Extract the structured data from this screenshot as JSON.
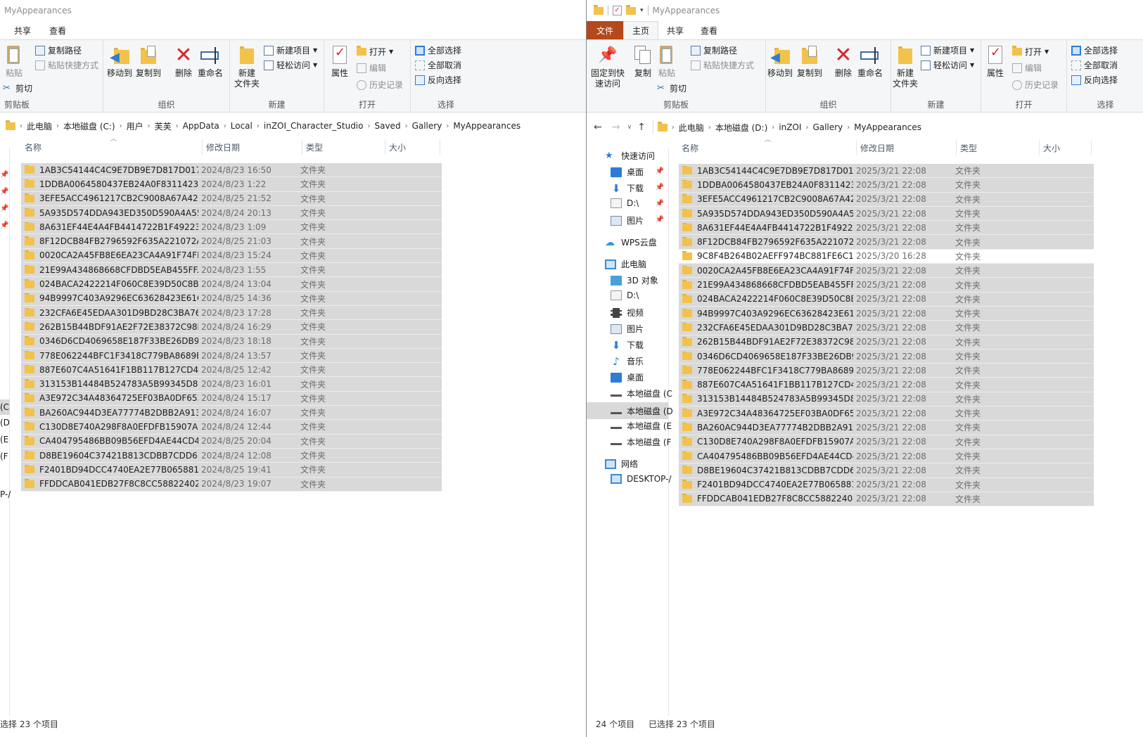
{
  "left": {
    "title": "MyAppearances",
    "tabs": [
      "共享",
      "查看"
    ],
    "ribbon": {
      "clipboard": {
        "group": "剪贴板",
        "paste": "粘贴",
        "copy_path": "复制路径",
        "paste_shortcut": "粘贴快捷方式",
        "cut": "剪切"
      },
      "organize": {
        "group": "组织",
        "move_to": "移动到",
        "copy_to": "复制到",
        "delete": "删除",
        "rename": "重命名"
      },
      "new": {
        "group": "新建",
        "new_folder": "新建\n文件夹",
        "new_item": "新建项目",
        "easy_access": "轻松访问"
      },
      "open": {
        "group": "打开",
        "properties": "属性",
        "open": "打开",
        "edit": "编辑",
        "history": "历史记录"
      },
      "select": {
        "group": "选择",
        "select_all": "全部选择",
        "select_none": "全部取消",
        "invert": "反向选择"
      }
    },
    "breadcrumb": [
      "此电脑",
      "本地磁盘 (C:)",
      "用户",
      "芙芙",
      "AppData",
      "Local",
      "inZOI_Character_Studio",
      "Saved",
      "Gallery",
      "MyAppearances"
    ],
    "columns": [
      "名称",
      "修改日期",
      "类型",
      "大小"
    ],
    "nav_fragments": [
      "(C",
      "(D",
      "(E",
      "(F",
      "P-/"
    ],
    "files": [
      {
        "name": "1AB3C54144C4C9E7DB9E7D817D017...",
        "date": "2024/8/23 16:50",
        "type": "文件夹"
      },
      {
        "name": "1DDBA0064580437EB24A0F83114231...",
        "date": "2024/8/23 1:22",
        "type": "文件夹"
      },
      {
        "name": "3EFE5ACC4961217CB2C9008A67A428...",
        "date": "2024/8/25 21:52",
        "type": "文件夹"
      },
      {
        "name": "5A935D574DDA943ED350D590A4A55...",
        "date": "2024/8/24 20:13",
        "type": "文件夹"
      },
      {
        "name": "8A631EF44E4A4FB4414722B1F49223F6",
        "date": "2024/8/23 1:09",
        "type": "文件夹"
      },
      {
        "name": "8F12DCB84FB2796592F635A221072A...",
        "date": "2024/8/25 21:03",
        "type": "文件夹"
      },
      {
        "name": "0020CA2A45FB8E6EA23CA4A91F74FF...",
        "date": "2024/8/23 15:24",
        "type": "文件夹"
      },
      {
        "name": "21E99A434868668CFDBD5EAB455FF...",
        "date": "2024/8/23 1:55",
        "type": "文件夹"
      },
      {
        "name": "024BACA2422214F060C8E39D50C8B...",
        "date": "2024/8/24 13:04",
        "type": "文件夹"
      },
      {
        "name": "94B9997C403A9296EC63628423E61C...",
        "date": "2024/8/25 14:36",
        "type": "文件夹"
      },
      {
        "name": "232CFA6E45EDAA301D9BD28C3BA76...",
        "date": "2024/8/23 17:28",
        "type": "文件夹"
      },
      {
        "name": "262B15B44BDF91AE2F72E38372C98E...",
        "date": "2024/8/24 16:29",
        "type": "文件夹"
      },
      {
        "name": "0346D6CD4069658E187F33BE26DB9...",
        "date": "2024/8/23 18:18",
        "type": "文件夹"
      },
      {
        "name": "778E062244BFC1F3418C779BA8689B...",
        "date": "2024/8/24 13:57",
        "type": "文件夹"
      },
      {
        "name": "887E607C4A51641F1BB117B127CD4...",
        "date": "2024/8/25 12:42",
        "type": "文件夹"
      },
      {
        "name": "313153B14484B524783A5B99345D89...",
        "date": "2024/8/23 16:01",
        "type": "文件夹"
      },
      {
        "name": "A3E972C34A48364725EF03BA0DF653...",
        "date": "2024/8/24 15:17",
        "type": "文件夹"
      },
      {
        "name": "BA260AC944D3EA77774B2DBB2A913...",
        "date": "2024/8/24 16:07",
        "type": "文件夹"
      },
      {
        "name": "C130D8E740A298F8A0EFDFB15907A5...",
        "date": "2024/8/24 12:44",
        "type": "文件夹"
      },
      {
        "name": "CA404795486BB09B56EFD4AE44CD4...",
        "date": "2024/8/25 20:04",
        "type": "文件夹"
      },
      {
        "name": "D8BE19604C37421B813CDBB7CDD6...",
        "date": "2024/8/24 12:08",
        "type": "文件夹"
      },
      {
        "name": "F2401BD94DCC4740EA2E77B065881F...",
        "date": "2024/8/25 19:41",
        "type": "文件夹"
      },
      {
        "name": "FFDDCAB041EDB27F8C8CC58822402...",
        "date": "2024/8/23 19:07",
        "type": "文件夹"
      }
    ],
    "status": "选择 23 个项目"
  },
  "right": {
    "title": "MyAppearances",
    "tabs": [
      "文件",
      "主页",
      "共享",
      "查看"
    ],
    "ribbon": {
      "clipboard": {
        "group": "剪贴板",
        "pin": "固定到快\n速访问",
        "copy": "复制",
        "paste": "粘贴",
        "copy_path": "复制路径",
        "paste_shortcut": "粘贴快捷方式",
        "cut": "剪切"
      },
      "organize": {
        "group": "组织",
        "move_to": "移动到",
        "copy_to": "复制到",
        "delete": "删除",
        "rename": "重命名"
      },
      "new": {
        "group": "新建",
        "new_folder": "新建\n文件夹",
        "new_item": "新建项目",
        "easy_access": "轻松访问"
      },
      "open": {
        "group": "打开",
        "properties": "属性",
        "open": "打开",
        "edit": "编辑",
        "history": "历史记录"
      },
      "select": {
        "group": "选择",
        "select_all": "全部选择",
        "select_none": "全部取消",
        "invert": "反向选择"
      }
    },
    "breadcrumb": [
      "此电脑",
      "本地磁盘 (D:)",
      "inZOI",
      "Gallery",
      "MyAppearances"
    ],
    "columns": [
      "名称",
      "修改日期",
      "类型",
      "大小"
    ],
    "nav": {
      "quick_access": "快速访问",
      "quick_items": [
        "桌面",
        "下载",
        "D:\\",
        "图片"
      ],
      "wps": "WPS云盘",
      "this_pc": "此电脑",
      "pc_items": [
        "3D 对象",
        "D:\\",
        "视频",
        "图片",
        "下载",
        "音乐",
        "桌面",
        "本地磁盘 (C",
        "本地磁盘 (D",
        "本地磁盘 (E",
        "本地磁盘 (F"
      ],
      "network": "网络",
      "desktop": "DESKTOP-/"
    },
    "files": [
      {
        "name": "1AB3C54144C4C9E7DB9E7D817D017...",
        "date": "2025/3/21 22:08",
        "type": "文件夹",
        "selected": true
      },
      {
        "name": "1DDBA0064580437EB24A0F83114231...",
        "date": "2025/3/21 22:08",
        "type": "文件夹",
        "selected": true
      },
      {
        "name": "3EFE5ACC4961217CB2C9008A67A428...",
        "date": "2025/3/21 22:08",
        "type": "文件夹",
        "selected": true
      },
      {
        "name": "5A935D574DDA943ED350D590A4A55...",
        "date": "2025/3/21 22:08",
        "type": "文件夹",
        "selected": true
      },
      {
        "name": "8A631EF44E4A4FB4414722B1F49223F6",
        "date": "2025/3/21 22:08",
        "type": "文件夹",
        "selected": true
      },
      {
        "name": "8F12DCB84FB2796592F635A221072A...",
        "date": "2025/3/21 22:08",
        "type": "文件夹",
        "selected": true
      },
      {
        "name": "9C8F4B264B02AEFF974BC881FE6C14...",
        "date": "2025/3/20 16:28",
        "type": "文件夹",
        "selected": false
      },
      {
        "name": "0020CA2A45FB8E6EA23CA4A91F74FF...",
        "date": "2025/3/21 22:08",
        "type": "文件夹",
        "selected": true
      },
      {
        "name": "21E99A434868668CFDBD5EAB455FF...",
        "date": "2025/3/21 22:08",
        "type": "文件夹",
        "selected": true
      },
      {
        "name": "024BACA2422214F060C8E39D50C8B...",
        "date": "2025/3/21 22:08",
        "type": "文件夹",
        "selected": true
      },
      {
        "name": "94B9997C403A9296EC63628423E61C...",
        "date": "2025/3/21 22:08",
        "type": "文件夹",
        "selected": true
      },
      {
        "name": "232CFA6E45EDAA301D9BD28C3BA76...",
        "date": "2025/3/21 22:08",
        "type": "文件夹",
        "selected": true
      },
      {
        "name": "262B15B44BDF91AE2F72E38372C98E...",
        "date": "2025/3/21 22:08",
        "type": "文件夹",
        "selected": true
      },
      {
        "name": "0346D6CD4069658E187F33BE26DB9...",
        "date": "2025/3/21 22:08",
        "type": "文件夹",
        "selected": true
      },
      {
        "name": "778E062244BFC1F3418C779BA8689B...",
        "date": "2025/3/21 22:08",
        "type": "文件夹",
        "selected": true
      },
      {
        "name": "887E607C4A51641F1BB117B127CD4...",
        "date": "2025/3/21 22:08",
        "type": "文件夹",
        "selected": true
      },
      {
        "name": "313153B14484B524783A5B99345D89...",
        "date": "2025/3/21 22:08",
        "type": "文件夹",
        "selected": true
      },
      {
        "name": "A3E972C34A48364725EF03BA0DF653...",
        "date": "2025/3/21 22:08",
        "type": "文件夹",
        "selected": true
      },
      {
        "name": "BA260AC944D3EA77774B2DBB2A913...",
        "date": "2025/3/21 22:08",
        "type": "文件夹",
        "selected": true
      },
      {
        "name": "C130D8E740A298F8A0EFDFB15907A5...",
        "date": "2025/3/21 22:08",
        "type": "文件夹",
        "selected": true
      },
      {
        "name": "CA404795486BB09B56EFD4AE44CD4...",
        "date": "2025/3/21 22:08",
        "type": "文件夹",
        "selected": true
      },
      {
        "name": "D8BE19604C37421B813CDBB7CDD6...",
        "date": "2025/3/21 22:08",
        "type": "文件夹",
        "selected": true
      },
      {
        "name": "F2401BD94DCC4740EA2E77B065881F...",
        "date": "2025/3/21 22:08",
        "type": "文件夹",
        "selected": true
      },
      {
        "name": "FFDDCAB041EDB27F8C8CC58822402...",
        "date": "2025/3/21 22:08",
        "type": "文件夹",
        "selected": true
      }
    ],
    "status_count": "24 个项目",
    "status_selected": "已选择 23 个项目"
  },
  "colors": {
    "file_tab": "#b5481c",
    "selection": "#d9d9d9",
    "folder": "#f2c24a",
    "delete_red": "#d6262d",
    "accent_blue": "#2d7cd6"
  }
}
